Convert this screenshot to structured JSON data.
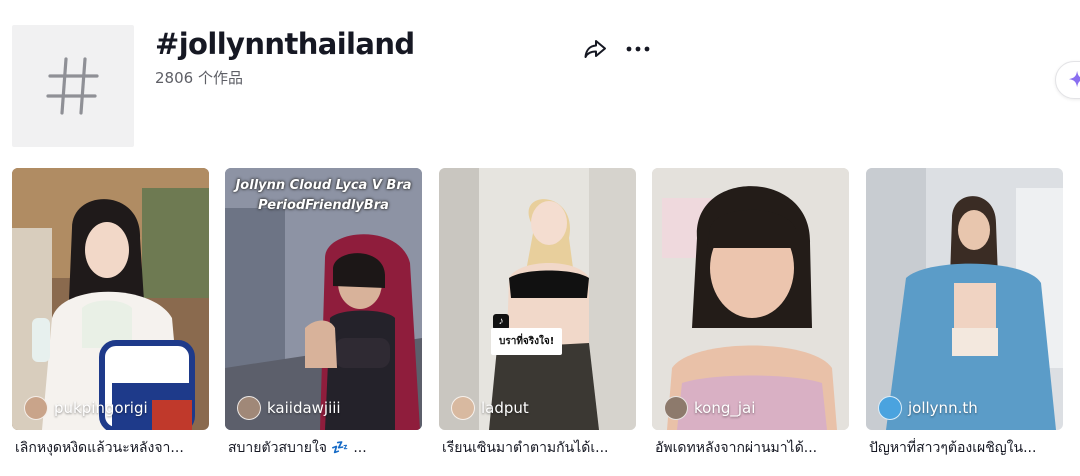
{
  "header": {
    "title": "#jollynnthailand",
    "subtitle": "2806 个作品",
    "thumb_icon": "hashtag-icon",
    "share_icon": "share-arrow-icon",
    "more_icon": "ellipsis-icon",
    "side_icon": "sparkle-icon"
  },
  "videos": [
    {
      "author": "pukpingorigi",
      "caption": "เลิกหงุดหงิดแล้วนะหลังจา..."
    },
    {
      "author": "kaiidawjiii",
      "caption": "สบายตัวสบายใจ 💤 ...",
      "overlay_line1": "Jollynn Cloud Lyca V Bra",
      "overlay_line2": "PeriodFriendlyBra"
    },
    {
      "author": "ladput",
      "caption": "เรียนเซินมาตำตามกันได้เ...",
      "sticker": "บราที่จริงใจ!"
    },
    {
      "author": "kong_jai",
      "caption": "อัพเดทหลังจากผ่านมาได้..."
    },
    {
      "author": "jollynn.th",
      "caption": "ปัญหาที่สาวๆต้องเผชิญใน..."
    }
  ],
  "colors": {
    "text": "#161823",
    "subtext": "#5e5f66",
    "accent_sparkle": "#8a6ff0"
  }
}
